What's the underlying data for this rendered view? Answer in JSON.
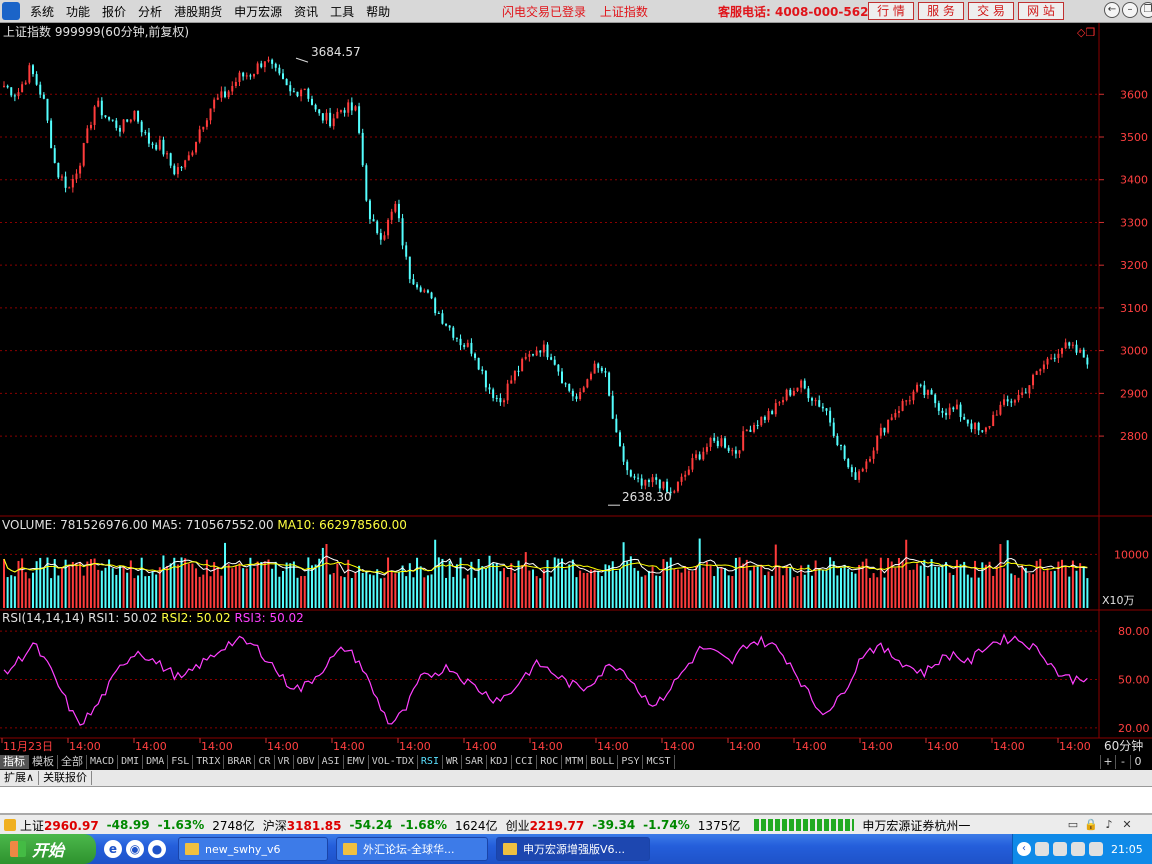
{
  "menubar": {
    "items": [
      "系统",
      "功能",
      "报价",
      "分析",
      "港股期货",
      "申万宏源",
      "资讯",
      "工具",
      "帮助"
    ],
    "status": [
      "闪电交易已登录",
      "上证指数"
    ],
    "hotline": "客服电话: 4008-000-562",
    "tab_buttons": [
      "行 情",
      "服 务",
      "交 易",
      "网 站"
    ],
    "window_controls": [
      "←",
      "–",
      "❐",
      "✕"
    ]
  },
  "chart_header": "上证指数 999999(60分钟,前复权)",
  "volume_header": {
    "label": "VOLUME: 781526976.00",
    "ma5": "MA5: 710567552.00",
    "ma10": "MA10: 662978560.00"
  },
  "rsi_header": {
    "label": "RSI(14,14,14)",
    "rsi1": "RSI1: 50.02",
    "rsi2": "RSI2: 50.02",
    "rsi3": "RSI3: 50.02"
  },
  "volume_unit": "X10万",
  "period": "60分钟",
  "time_axis": [
    "11月23日",
    "14:00",
    "14:00",
    "14:00",
    "14:00",
    "14:00",
    "14:00",
    "14:00",
    "14:00",
    "14:00",
    "14:00",
    "14:00",
    "14:00",
    "14:00",
    "14:00",
    "14:00",
    "14:00"
  ],
  "colors": {
    "up": "#ff3c3c",
    "down": "#54ffff",
    "ma5": "#ffffff",
    "ma10": "#ffff00",
    "rsi": "#ff40ff",
    "grid": "#8a0000"
  },
  "chart_data": {
    "type": "candlestick",
    "price_axis": {
      "ticks": [
        3600,
        3500,
        3400,
        3300,
        3200,
        3100,
        3000,
        2900,
        2800
      ],
      "min": 2620,
      "max": 3720
    },
    "max_label": "3684.57",
    "min_label": "2638.30",
    "price_path": [
      3620,
      3600,
      3660,
      3590,
      3420,
      3380,
      3460,
      3580,
      3540,
      3520,
      3560,
      3490,
      3480,
      3420,
      3440,
      3520,
      3580,
      3600,
      3640,
      3650,
      3684.57,
      3640,
      3600,
      3620,
      3550,
      3540,
      3570,
      3560,
      3300,
      3270,
      3340,
      3180,
      3150,
      3100,
      3060,
      3020,
      3000,
      2920,
      2880,
      2940,
      2980,
      3010,
      2990,
      2920,
      2880,
      2960,
      2950,
      2780,
      2700,
      2680,
      2700,
      2660,
      2700,
      2750,
      2780,
      2790,
      2760,
      2820,
      2840,
      2860,
      2900,
      2920,
      2890,
      2860,
      2780,
      2700,
      2740,
      2800,
      2850,
      2880,
      2910,
      2890,
      2860,
      2860,
      2830,
      2800,
      2860,
      2880,
      2900,
      2940,
      2980,
      3010,
      3000,
      2980
    ],
    "low_mark": 2638.3,
    "volume_axis": {
      "ticks": [
        10000
      ],
      "max": 14000
    },
    "rsi_axis": {
      "ticks": [
        80.0,
        50.0,
        20.0
      ],
      "min": 15,
      "max": 85
    },
    "rsi_path": [
      53,
      62,
      72,
      58,
      40,
      22,
      30,
      45,
      60,
      68,
      62,
      56,
      50,
      58,
      64,
      72,
      74,
      70,
      60,
      48,
      44,
      52,
      62,
      70,
      60,
      40,
      22,
      30,
      50,
      54,
      58,
      50,
      44,
      38,
      40,
      52,
      60,
      54,
      48,
      44,
      52,
      60,
      54,
      40,
      34,
      46,
      58,
      70,
      66,
      60,
      72,
      74,
      70,
      60,
      44,
      30,
      34,
      50,
      68,
      70,
      64,
      58,
      54,
      62,
      66,
      60,
      70,
      74,
      76,
      72,
      66,
      54,
      50,
      52
    ],
    "rsi_label_values": [
      "80.00",
      "50.00",
      "20.00"
    ],
    "price_labels": [
      "3600",
      "3500",
      "3400",
      "3300",
      "3200",
      "3100",
      "3000",
      "2900",
      "2800"
    ],
    "volume_label": "10000"
  },
  "indicator_tabs": [
    "指标",
    "模板",
    "全部",
    "MACD",
    "DMI",
    "DMA",
    "FSL",
    "TRIX",
    "BRAR",
    "CR",
    "VR",
    "OBV",
    "ASI",
    "EMV",
    "VOL-TDX",
    "RSI",
    "WR",
    "SAR",
    "KDJ",
    "CCI",
    "ROC",
    "MTM",
    "BOLL",
    "PSY",
    "MCST"
  ],
  "indicator_right": [
    "+",
    "-",
    "0"
  ],
  "sub_tabs": [
    "扩展∧",
    "关联报价"
  ],
  "status_bar": {
    "sh": {
      "name": "上证",
      "value": "2960.97",
      "chg": "-48.99",
      "pct": "-1.63%",
      "vol": "2748亿"
    },
    "hs": {
      "name": "沪深",
      "value": "3181.85",
      "chg": "-54.24",
      "pct": "-1.68%",
      "vol": "1624亿"
    },
    "cy": {
      "name": "创业",
      "value": "2219.77",
      "chg": "-39.34",
      "pct": "-1.74%",
      "vol": "1375亿"
    },
    "broker": "申万宏源证券杭州一"
  },
  "taskbar": {
    "start": "开始",
    "tasks": [
      "new_swhy_v6",
      "外汇论坛-全球华...",
      "申万宏源增强版V6..."
    ],
    "clock": "21:05"
  }
}
